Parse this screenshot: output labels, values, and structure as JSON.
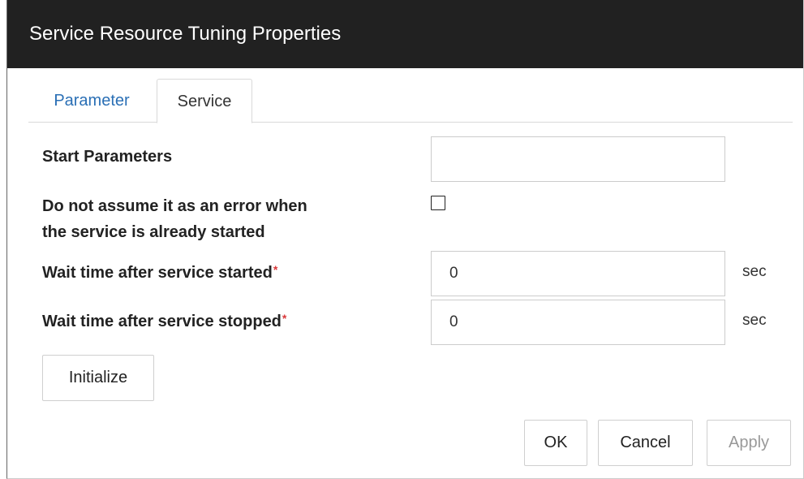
{
  "dialog": {
    "title": "Service Resource Tuning Properties",
    "tabs": [
      {
        "label": "Parameter",
        "active": false
      },
      {
        "label": "Service",
        "active": true
      }
    ]
  },
  "form": {
    "start_parameters": {
      "label": "Start Parameters",
      "value": ""
    },
    "no_error_if_started": {
      "label_line1": "Do not assume it as an error when",
      "label_line2": "the service is already started",
      "checked": false
    },
    "wait_after_started": {
      "label": "Wait time after service started",
      "required_mark": "*",
      "value": "0",
      "unit": "sec"
    },
    "wait_after_stopped": {
      "label": "Wait time after service stopped",
      "required_mark": "*",
      "value": "0",
      "unit": "sec"
    }
  },
  "buttons": {
    "initialize": "Initialize",
    "ok": "OK",
    "cancel": "Cancel",
    "apply": "Apply"
  },
  "colors": {
    "titlebar_bg": "#212121",
    "tab_link": "#2a6fb5",
    "required_mark": "#d9383a",
    "disabled_text": "#999999"
  }
}
